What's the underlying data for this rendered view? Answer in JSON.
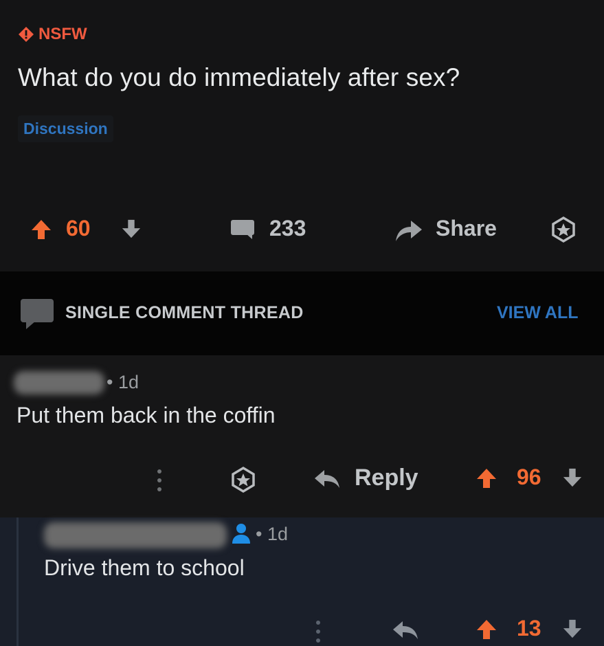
{
  "post": {
    "nsfw_label": "NSFW",
    "title": "What do you do immediately after sex?",
    "flair": "Discussion",
    "score": "60",
    "comments": "233",
    "share_label": "Share"
  },
  "thread": {
    "label": "SINGLE COMMENT THREAD",
    "view_all": "VIEW ALL"
  },
  "comments": [
    {
      "time": "• 1d",
      "body": "Put them back in the coffin",
      "reply_label": "Reply",
      "score": "96"
    },
    {
      "time": "• 1d",
      "body": "Drive them to school",
      "score": "13"
    }
  ],
  "colors": {
    "upvote": "#f26a33",
    "nsfw": "#f05a3f",
    "link": "#2f75c0",
    "background": "#0e0e0f"
  },
  "icons": {
    "nsfw": "nsfw-diamond-icon",
    "upvote": "upvote-arrow-icon",
    "downvote": "downvote-arrow-icon",
    "comment": "comment-bubble-icon",
    "share": "share-arrow-icon",
    "award": "award-icon",
    "more": "more-vertical-icon",
    "reply": "reply-arrow-icon",
    "person": "person-icon"
  }
}
